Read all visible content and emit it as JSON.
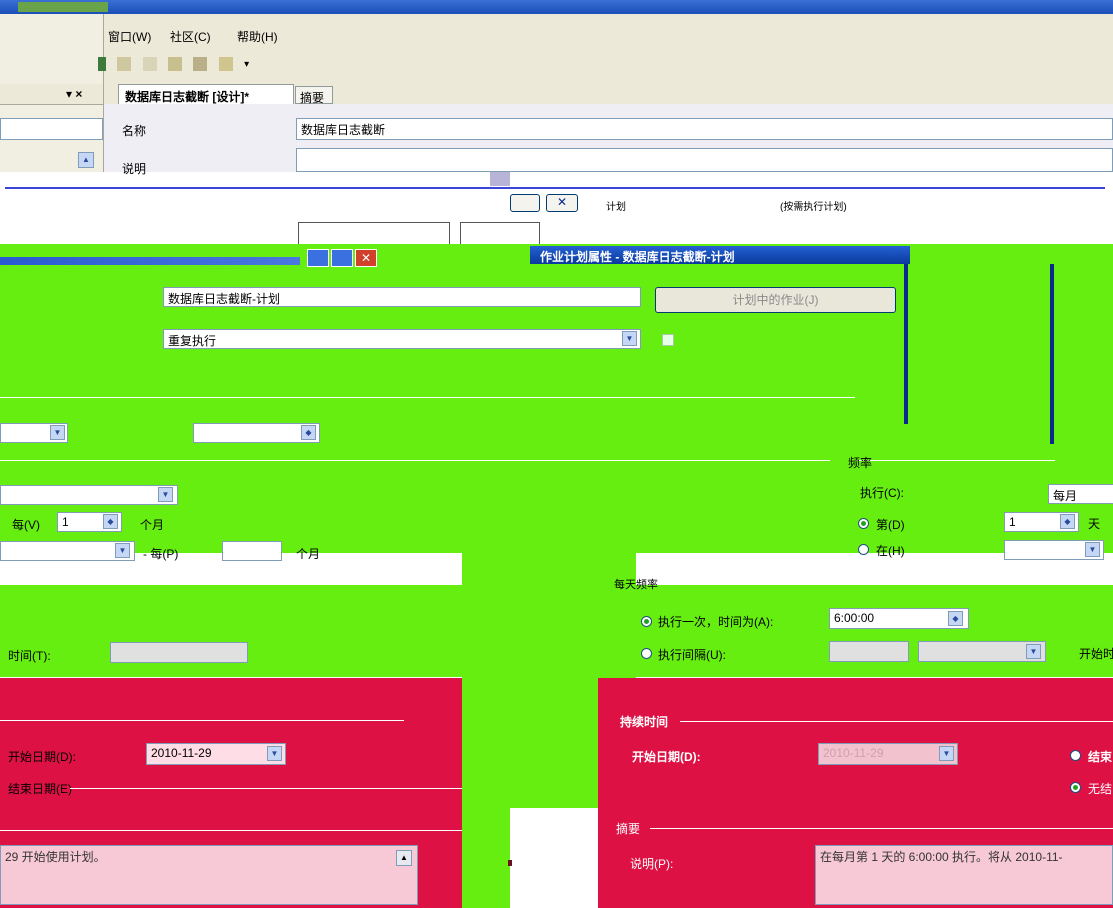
{
  "menu": {
    "window": "窗口(W)",
    "community": "社区(C)",
    "help": "帮助(H)"
  },
  "doc_tabs": {
    "active": "数据库日志截断 [设计]*",
    "summary": "摘要"
  },
  "panel_close_glyphs": "▾ ×",
  "properties": {
    "name_label": "名称",
    "name_value": "数据库日志截断",
    "desc_label": "说明"
  },
  "strip": {
    "plan_label": "计划",
    "plan_value": "(按需执行计划)"
  },
  "dialog": {
    "title": "作业计划属性 - 数据库日志截断-计划",
    "name_value": "数据库日志截断-计划",
    "jobs_button": "计划中的作业(J)",
    "schedule_type": "重复执行",
    "frequency": {
      "group": "频率",
      "execute_label": "执行(C):",
      "execute_value": "每月",
      "every_label": "每(V)",
      "every_value": "1",
      "months": "个月",
      "every_label2": "- 每(P)",
      "months2": "个月",
      "day_radio": "第(D)",
      "day_value": "1",
      "day_unit": "天",
      "on_radio": "在(H)"
    },
    "daily": {
      "group": "每天频率",
      "once_radio": "执行一次，时间为(A):",
      "once_time": "6:00:00",
      "interval_radio": "执行间隔(U):",
      "start_label": "开始时",
      "time_label_left": "时间(T):"
    },
    "duration": {
      "group": "持续时间",
      "start_date_label": "开始日期(D):",
      "start_date_value": "2010-11-29",
      "end_radio": "结束",
      "no_end_radio": "无结",
      "left_start_label": "开始日期(D):",
      "left_start_value": "2010-11-29",
      "left_end_label": "结束日期(E)"
    },
    "summary": {
      "group": "摘要",
      "desc_label": "说明(P):",
      "desc_value": "在每月第 1 天的 6:00:00 执行。将从 2010-11-",
      "left_desc": "29 开始使用计划。"
    },
    "colors": {
      "green": "#66ee11",
      "red": "#dd1144",
      "title_blue": "#0a3a9c"
    }
  }
}
